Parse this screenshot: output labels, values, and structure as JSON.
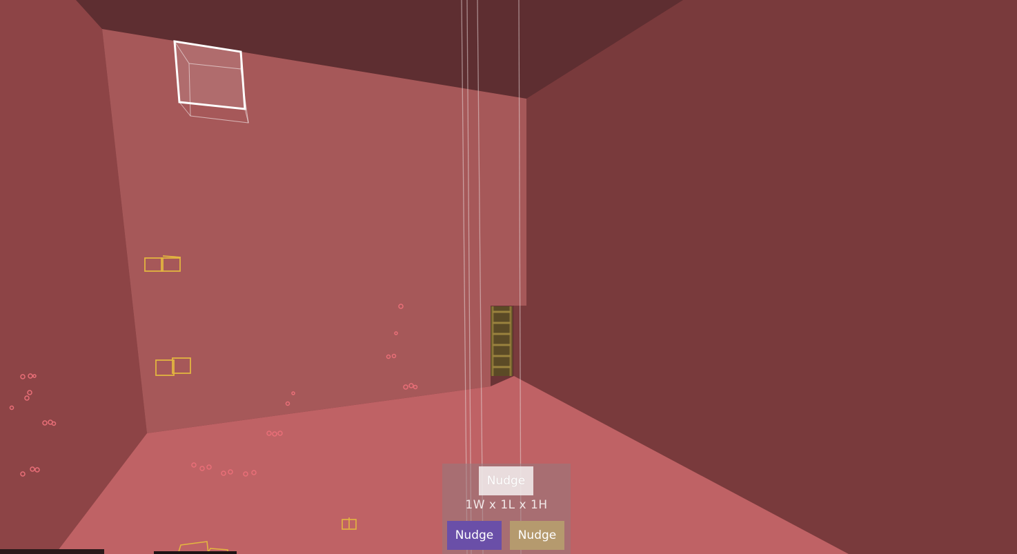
{
  "hud": {
    "top_button_label": "Nudge",
    "dimensions_text": "1W x 1L x 1H",
    "left_button_label": "Nudge",
    "right_button_label": "Nudge"
  },
  "colors": {
    "ceiling": "#5a2b2e",
    "back_wall": "#a85a5c",
    "left_wall": "#8e4547",
    "right_wall": "#7a3b3d",
    "floor": "#c06467",
    "purple_button": "#6a4fa8",
    "tan_button": "#b59a6e"
  }
}
